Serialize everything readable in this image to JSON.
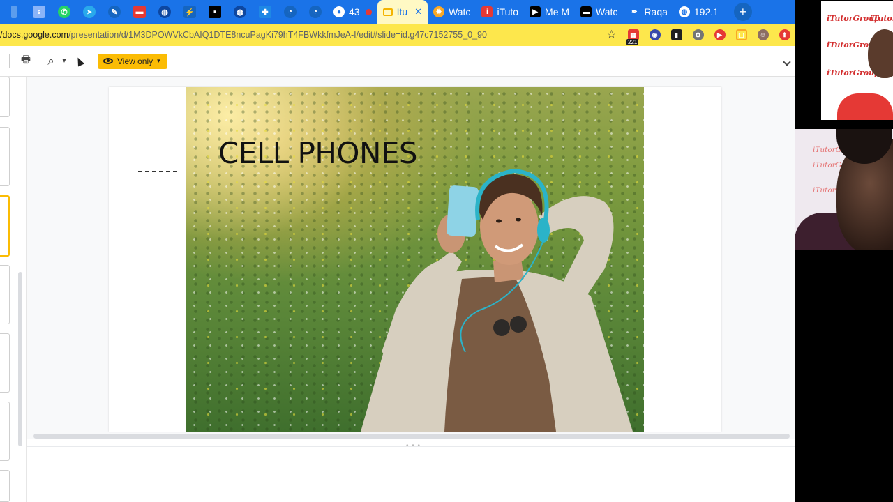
{
  "tabs": {
    "icons": [
      {
        "name": "tab-favicon-1",
        "glyph": "",
        "color": "#1a73e8"
      },
      {
        "name": "tab-favicon-2",
        "glyph": "",
        "color": "#5c9ded"
      },
      {
        "name": "whatsapp-tab-icon",
        "glyph": "✆",
        "color": "#25d366"
      },
      {
        "name": "telegram-tab-icon",
        "glyph": "➤",
        "color": "#29a9eb"
      },
      {
        "name": "tab-favicon-5",
        "glyph": "✎",
        "color": "#1565c0"
      },
      {
        "name": "tab-favicon-6",
        "glyph": "▣",
        "color": "#e53935"
      },
      {
        "name": "tab-favicon-7",
        "glyph": "●",
        "color": "#0d47a1"
      },
      {
        "name": "tab-favicon-8",
        "glyph": "⚡",
        "color": "#1565c0"
      },
      {
        "name": "tab-favicon-9",
        "glyph": "■",
        "color": "#000000"
      },
      {
        "name": "tab-favicon-10",
        "glyph": "●",
        "color": "#0d47a1"
      },
      {
        "name": "tab-favicon-11",
        "glyph": "✚",
        "color": "#1e88e5"
      },
      {
        "name": "tab-favicon-12",
        "glyph": "◔",
        "color": "#1565c0"
      },
      {
        "name": "tab-favicon-13",
        "glyph": "◔",
        "color": "#1565c0"
      }
    ],
    "tab_43": "43",
    "active_title": "Itu",
    "others": [
      {
        "title": "Watc",
        "icon": "gear-icon",
        "color": "#f9a825"
      },
      {
        "title": "iTuto",
        "icon": "i-icon",
        "color": "#e53935"
      },
      {
        "title": "Me M",
        "icon": "play-icon",
        "color": "#000000"
      },
      {
        "title": "Watc",
        "icon": "square-icon",
        "color": "#000000"
      },
      {
        "title": "Raqa",
        "icon": "pen-icon",
        "color": "#1565c0"
      },
      {
        "title": "192.1",
        "icon": "globe-icon",
        "color": "#1e88e5"
      }
    ],
    "new_tab": "+"
  },
  "address": {
    "host": "/docs.google.com",
    "path": "/presentation/d/1M3DPOWVkCbAIQ1DTE8ncuPagKi79hT4FBWkkfmJeA-I/edit#slide=id.g47c7152755_0_90",
    "star": "☆",
    "badge_count": "221"
  },
  "toolbar": {
    "print_icon": "🖶",
    "zoom_icon": "⌕",
    "zoom_caret": "▾",
    "pointer_icon": "➤",
    "view_only_label": "View only",
    "view_only_caret": "▾",
    "collapse_icon": "⌄"
  },
  "slide": {
    "title": "CELL PHONES"
  },
  "notes": {
    "grip": "• • •"
  },
  "videos": {
    "watermark": "iTutorGroup"
  },
  "colors": {
    "tabstrip": "#1a73e8",
    "addressbar": "#fde74c",
    "view_only": "#fbbc04"
  }
}
